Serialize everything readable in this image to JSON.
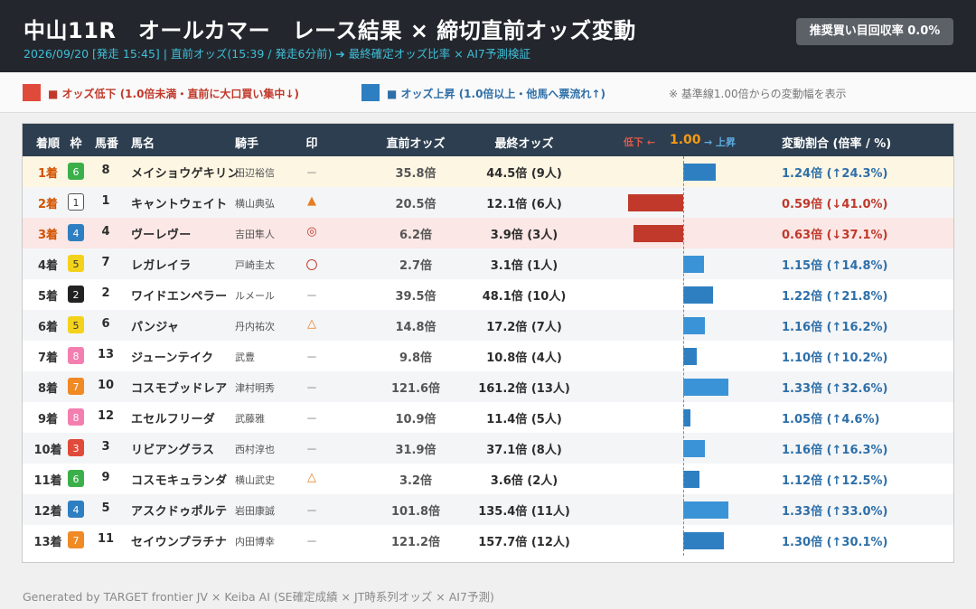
{
  "header": {
    "title": "中山11R　オールカマー　レース結果 × 締切直前オッズ変動",
    "subtitle": "2026/09/20 [発走 15:45]  |  直前オッズ(15:39 / 発走6分前) ➔ 最終確定オッズ比率  ×  AI7予測検証",
    "roi_button": "推奨買い目回収率 0.0%"
  },
  "legend": {
    "down_label": "■ オッズ低下 (1.0倍未満・直前に大口買い集中↓)",
    "up_label": "■ オッズ上昇 (1.0倍以上・他馬へ票流れ↑)",
    "note": "※ 基準線1.00倍からの変動幅を表示",
    "colors": {
      "down": "#e04a3a",
      "up": "#2e7fc1"
    }
  },
  "table": {
    "headers": {
      "rank": "着順",
      "waku": "枠",
      "num": "馬番",
      "name": "馬名",
      "jockey": "騎手",
      "mark": "印",
      "pre_odds": "直前オッズ",
      "final_odds": "最終オッズ",
      "axis_down": "低下 ←",
      "axis_base": "1.00",
      "axis_up": "→ 上昇",
      "ratio": "変動割合 (倍率 / %)"
    }
  },
  "waku_colors": {
    "1": {
      "bg": "#ffffff",
      "fg": "#333333",
      "border": "#555555"
    },
    "2": {
      "bg": "#222222",
      "fg": "#ffffff",
      "border": "#222222"
    },
    "3": {
      "bg": "#e04a3a",
      "fg": "#ffffff",
      "border": "#e04a3a"
    },
    "4": {
      "bg": "#2e7fc1",
      "fg": "#ffffff",
      "border": "#2e7fc1"
    },
    "5": {
      "bg": "#f3d21b",
      "fg": "#333333",
      "border": "#f3d21b"
    },
    "6": {
      "bg": "#3bb04a",
      "fg": "#ffffff",
      "border": "#3bb04a"
    },
    "7": {
      "bg": "#ef8a25",
      "fg": "#ffffff",
      "border": "#ef8a25"
    },
    "8": {
      "bg": "#f37fb0",
      "fg": "#ffffff",
      "border": "#f37fb0"
    }
  },
  "chart_data": {
    "type": "bar",
    "title": "中山11R　オールカマー　レース結果 × 締切直前オッズ変動",
    "baseline": 1.0,
    "xlim": [
      0.0,
      2.0
    ],
    "rows": [
      {
        "rank": "1着",
        "waku": "6",
        "num": "8",
        "name": "メイショウゲキリン",
        "jockey": "田辺裕信",
        "mark": "－",
        "pre_odds": "35.8倍",
        "final_odds": "44.5倍 (9人)",
        "ratio": 1.24,
        "ratio_label": "1.24倍 (↑24.3%)"
      },
      {
        "rank": "2着",
        "waku": "1",
        "num": "1",
        "name": "キャントウェイト",
        "jockey": "横山典弘",
        "mark": "▲",
        "pre_odds": "20.5倍",
        "final_odds": "12.1倍 (6人)",
        "ratio": 0.59,
        "ratio_label": "0.59倍 (↓41.0%)"
      },
      {
        "rank": "3着",
        "waku": "4",
        "num": "4",
        "name": "ヴーレヴー",
        "jockey": "吉田隼人",
        "mark": "◎",
        "pre_odds": "6.2倍",
        "final_odds": "3.9倍 (3人)",
        "ratio": 0.63,
        "ratio_label": "0.63倍 (↓37.1%)"
      },
      {
        "rank": "4着",
        "waku": "5",
        "num": "7",
        "name": "レガレイラ",
        "jockey": "戸崎圭太",
        "mark": "〇",
        "pre_odds": "2.7倍",
        "final_odds": "3.1倍 (1人)",
        "ratio": 1.15,
        "ratio_label": "1.15倍 (↑14.8%)"
      },
      {
        "rank": "5着",
        "waku": "2",
        "num": "2",
        "name": "ワイドエンペラー",
        "jockey": "ルメール",
        "mark": "－",
        "pre_odds": "39.5倍",
        "final_odds": "48.1倍 (10人)",
        "ratio": 1.22,
        "ratio_label": "1.22倍 (↑21.8%)"
      },
      {
        "rank": "6着",
        "waku": "5",
        "num": "6",
        "name": "パンジャ",
        "jockey": "丹内祐次",
        "mark": "△",
        "pre_odds": "14.8倍",
        "final_odds": "17.2倍 (7人)",
        "ratio": 1.16,
        "ratio_label": "1.16倍 (↑16.2%)"
      },
      {
        "rank": "7着",
        "waku": "8",
        "num": "13",
        "name": "ジューンテイク",
        "jockey": "武豊",
        "mark": "－",
        "pre_odds": "9.8倍",
        "final_odds": "10.8倍 (4人)",
        "ratio": 1.1,
        "ratio_label": "1.10倍 (↑10.2%)"
      },
      {
        "rank": "8着",
        "waku": "7",
        "num": "10",
        "name": "コスモブッドレア",
        "jockey": "津村明秀",
        "mark": "－",
        "pre_odds": "121.6倍",
        "final_odds": "161.2倍 (13人)",
        "ratio": 1.33,
        "ratio_label": "1.33倍 (↑32.6%)"
      },
      {
        "rank": "9着",
        "waku": "8",
        "num": "12",
        "name": "エセルフリーダ",
        "jockey": "武藤雅",
        "mark": "－",
        "pre_odds": "10.9倍",
        "final_odds": "11.4倍 (5人)",
        "ratio": 1.05,
        "ratio_label": "1.05倍 (↑4.6%)"
      },
      {
        "rank": "10着",
        "waku": "3",
        "num": "3",
        "name": "リビアングラス",
        "jockey": "西村淳也",
        "mark": "－",
        "pre_odds": "31.9倍",
        "final_odds": "37.1倍 (8人)",
        "ratio": 1.16,
        "ratio_label": "1.16倍 (↑16.3%)"
      },
      {
        "rank": "11着",
        "waku": "6",
        "num": "9",
        "name": "コスモキュランダ",
        "jockey": "横山武史",
        "mark": "△",
        "pre_odds": "3.2倍",
        "final_odds": "3.6倍 (2人)",
        "ratio": 1.12,
        "ratio_label": "1.12倍 (↑12.5%)"
      },
      {
        "rank": "12着",
        "waku": "4",
        "num": "5",
        "name": "アスクドゥポルテ",
        "jockey": "岩田康誠",
        "mark": "－",
        "pre_odds": "101.8倍",
        "final_odds": "135.4倍 (11人)",
        "ratio": 1.33,
        "ratio_label": "1.33倍 (↑33.0%)"
      },
      {
        "rank": "13着",
        "waku": "7",
        "num": "11",
        "name": "セイウンプラチナ",
        "jockey": "内田博幸",
        "mark": "－",
        "pre_odds": "121.2倍",
        "final_odds": "157.7倍 (12人)",
        "ratio": 1.3,
        "ratio_label": "1.30倍 (↑30.1%)"
      }
    ]
  },
  "footer": "Generated by TARGET frontier JV × Keiba AI (SE確定成績 × JT時系列オッズ × AI7予測)"
}
